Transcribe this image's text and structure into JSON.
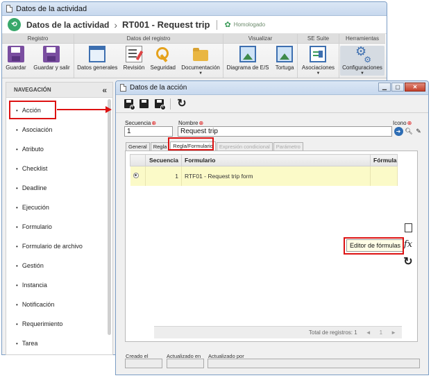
{
  "outer_window": {
    "title": "Datos de la actividad"
  },
  "header": {
    "section": "Datos de la actividad",
    "separator": "›",
    "record_title": "RT001 - Request trip",
    "status": "Homologado"
  },
  "ribbon": {
    "groups": [
      {
        "title": "Registro",
        "buttons": [
          {
            "label": "Guardar",
            "icon": "save-icon"
          },
          {
            "label": "Guardar y salir",
            "icon": "save-exit-icon"
          }
        ]
      },
      {
        "title": "Datos del registro",
        "buttons": [
          {
            "label": "Datos generales",
            "icon": "window-icon"
          },
          {
            "label": "Revisión",
            "icon": "review-icon"
          },
          {
            "label": "Seguridad",
            "icon": "key-icon"
          },
          {
            "label": "Documentación",
            "icon": "folder-icon",
            "dropdown": true
          }
        ]
      },
      {
        "title": "Visualizar",
        "buttons": [
          {
            "label": "Diagrama de E/S",
            "icon": "image-icon"
          },
          {
            "label": "Tortuga",
            "icon": "image-icon"
          }
        ]
      },
      {
        "title": "SE Suite",
        "buttons": [
          {
            "label": "Asociaciones",
            "icon": "associations-icon",
            "dropdown": true
          }
        ]
      },
      {
        "title": "Herramientas",
        "buttons": [
          {
            "label": "Configuraciones",
            "icon": "gears-icon",
            "dropdown": true
          }
        ]
      }
    ]
  },
  "nav": {
    "title": "NAVEGACIÓN",
    "collapse_icon": "«",
    "items": [
      {
        "label": "Acción"
      },
      {
        "label": "Asociación"
      },
      {
        "label": "Atributo"
      },
      {
        "label": "Checklist"
      },
      {
        "label": "Deadline"
      },
      {
        "label": "Ejecución"
      },
      {
        "label": "Formulario"
      },
      {
        "label": "Formulario de archivo"
      },
      {
        "label": "Gestión"
      },
      {
        "label": "Instancia"
      },
      {
        "label": "Notificación"
      },
      {
        "label": "Requerimiento"
      },
      {
        "label": "Tarea"
      }
    ]
  },
  "inner_window": {
    "title": "Datos de la acción",
    "controls": {
      "minimize": "▁",
      "maximize": "▢",
      "close": "✕"
    }
  },
  "form": {
    "secuencia_label": "Secuencia",
    "secuencia_value": "1",
    "nombre_label": "Nombre",
    "nombre_value": "Request trip",
    "icono_label": "Icono",
    "required_mark": "⊕"
  },
  "tabs": [
    {
      "label": "General",
      "state": "normal"
    },
    {
      "label": "Regla",
      "state": "normal"
    },
    {
      "label": "Regla/Formulario",
      "state": "active"
    },
    {
      "label": "Expresión condicional",
      "state": "disabled"
    },
    {
      "label": "Parámetro",
      "state": "disabled"
    }
  ],
  "grid": {
    "columns": [
      "",
      "Secuencia",
      "Formulario",
      "Fórmula"
    ],
    "rows": [
      {
        "secuencia": "1",
        "formulario": "RTF01 - Request trip form",
        "formula": ""
      }
    ],
    "footer": {
      "total": "Total de registros: 1",
      "page": "1",
      "prev": "◄",
      "next": "►"
    }
  },
  "side_tools": {
    "tooltip": "Editor de fórmulas"
  },
  "bottom": {
    "creado_label": "Creado el",
    "actualizado_label": "Actualizado en",
    "actualizado_por_label": "Actualizado por"
  },
  "colors": {
    "highlight": "#dd1111",
    "accent": "#2e6db4",
    "selected_row": "#fbfac8"
  }
}
